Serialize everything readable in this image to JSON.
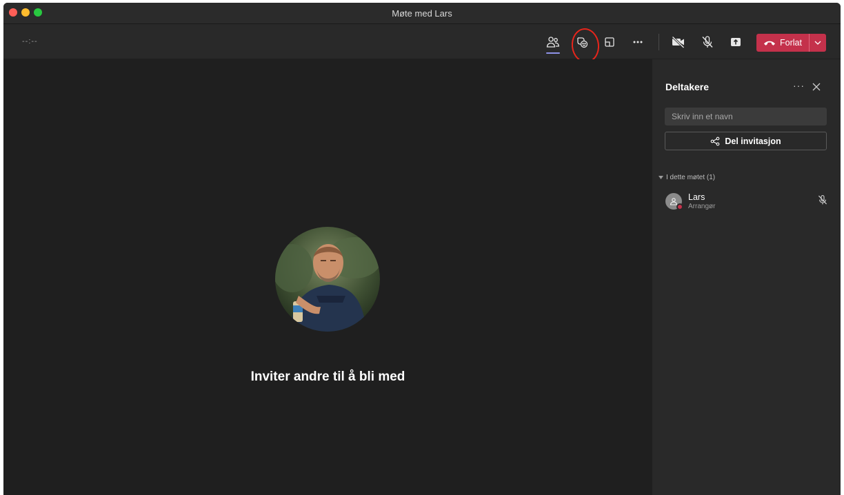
{
  "window": {
    "title": "Møte med Lars"
  },
  "toolbar": {
    "timer": "--:--",
    "leave_label": "Forlat"
  },
  "stage": {
    "invite_text": "Inviter andre til å bli med"
  },
  "panel": {
    "title": "Deltakere",
    "more_label": "···",
    "search_placeholder": "Skriv inn et navn",
    "share_label": "Del invitasjon",
    "section_label": "I dette møtet (1)",
    "participants": [
      {
        "name": "Lars",
        "role": "Arrangør",
        "status_color": "#c4314b"
      }
    ]
  },
  "colors": {
    "accent": "#8f93e8",
    "leave": "#c4314b",
    "annotation": "#e8251b"
  }
}
